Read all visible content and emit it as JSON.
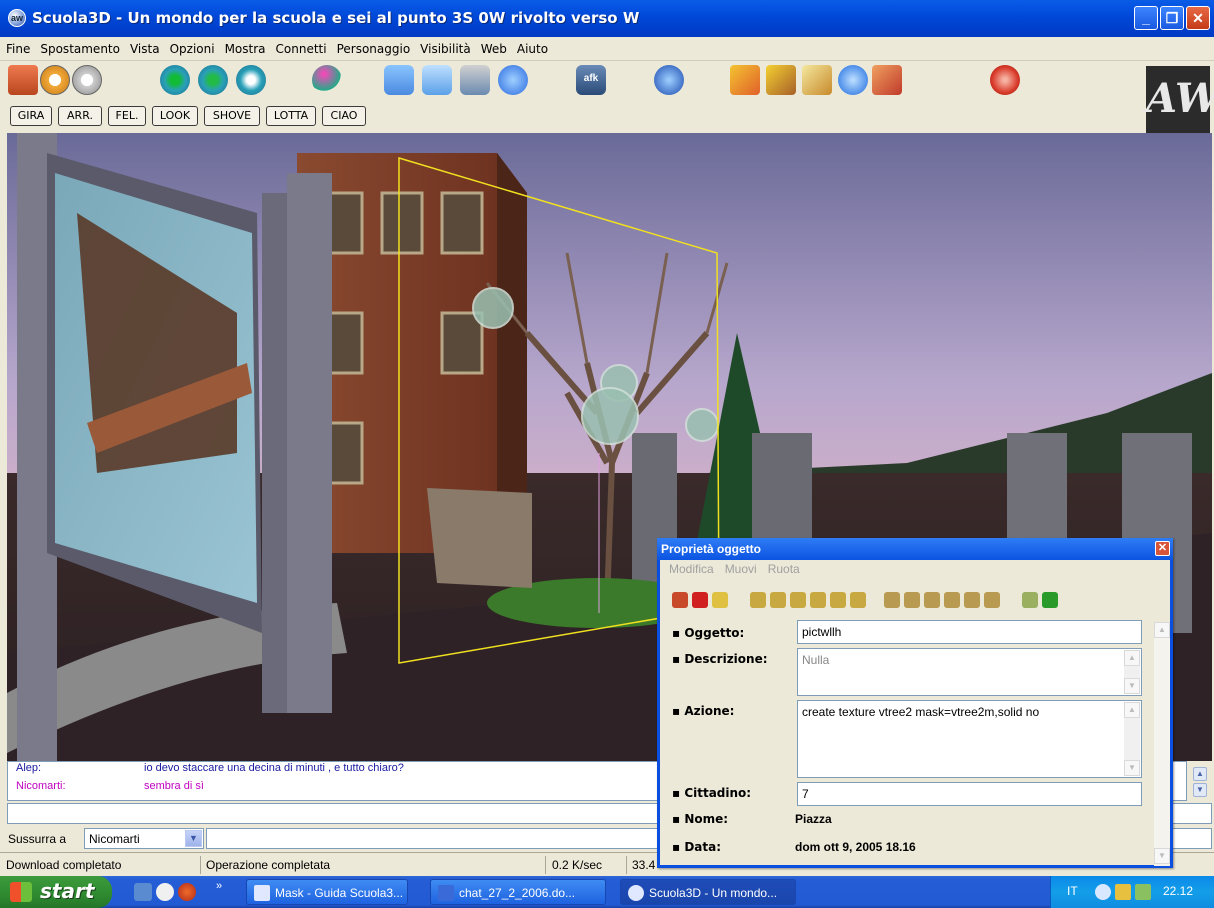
{
  "window": {
    "title": "Scuola3D - Un mondo per la scuola e sei al punto 3S 0W rivolto verso W",
    "controls": [
      "minimize",
      "maximize",
      "close"
    ]
  },
  "menu": [
    "Fine",
    "Spostamento",
    "Vista",
    "Opzioni",
    "Mostra",
    "Connetti",
    "Personaggio",
    "Visibilità",
    "Web",
    "Aiuto"
  ],
  "toolbar": {
    "afk_label": "afk",
    "logo": "AW"
  },
  "gestures": [
    "GIRA",
    "ARR.",
    "FEL.",
    "LOOK",
    "SHOVE",
    "LOTTA",
    "CIAO"
  ],
  "chat": {
    "messages": [
      {
        "name": "Alep:",
        "text": "io devo staccare una decina di minuti , e tutto chiaro?",
        "color": "#1a1aa0"
      },
      {
        "name": "Nicomarti:",
        "text": "sembra di sì",
        "color": "#c000c0"
      }
    ]
  },
  "whisper": {
    "label": "Sussurra a",
    "selected": "Nicomarti"
  },
  "status": {
    "download": "Download completato",
    "operation": "Operazione completata",
    "rate": "0.2 K/sec",
    "partial": "33.4"
  },
  "dialog": {
    "title": "Proprietà oggetto",
    "menu": [
      "Modifica",
      "Muovi",
      "Ruota"
    ],
    "fields": {
      "oggetto_label": "Oggetto:",
      "oggetto_value": "pictwllh",
      "descrizione_label": "Descrizione:",
      "descrizione_value": "Nulla",
      "azione_label": "Azione:",
      "azione_value": "create texture vtree2  mask=vtree2m,solid no",
      "cittadino_label": "Cittadino:",
      "cittadino_value": "7",
      "nome_label": "Nome:",
      "nome_value": "Piazza",
      "data_label": "Data:",
      "data_value": "dom ott 9, 2005 18.16"
    }
  },
  "taskbar": {
    "start": "start",
    "tasks": [
      "Mask - Guida Scuola3...",
      "chat_27_2_2006.do...",
      "Scuola3D - Un mondo..."
    ],
    "lang": "IT",
    "clock": "22.12"
  }
}
